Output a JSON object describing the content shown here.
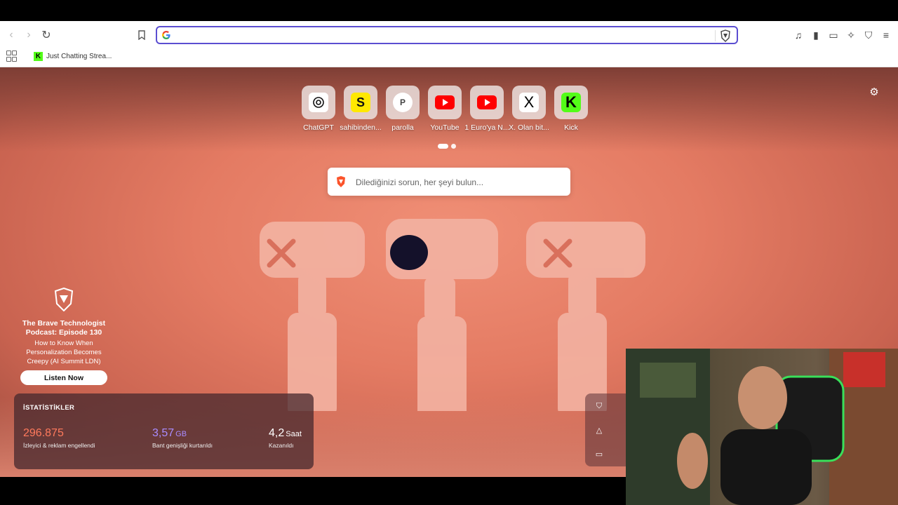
{
  "bookmarks": [
    {
      "label": "Just Chatting Strea..."
    }
  ],
  "address_bar": {
    "value": "",
    "placeholder": ""
  },
  "top_sites": [
    {
      "label": "ChatGPT",
      "icon": "chatgpt-icon"
    },
    {
      "label": "sahibinden...",
      "icon": "sahibinden-icon",
      "glyph": "S"
    },
    {
      "label": "parolla",
      "icon": "parolla-icon",
      "glyph": "P"
    },
    {
      "label": "YouTube",
      "icon": "youtube-icon"
    },
    {
      "label": "1 Euro'ya N...",
      "icon": "youtube-icon"
    },
    {
      "label": "X. Olan bit...",
      "icon": "x-icon",
      "glyph": "X"
    },
    {
      "label": "Kick",
      "icon": "kick-icon",
      "glyph": "K"
    }
  ],
  "search": {
    "placeholder": "Dilediğinizi sorun, her şeyi bulun..."
  },
  "sponsor": {
    "title": "The Brave Technologist Podcast: Episode 130",
    "description": "How to Know When Personalization Becomes Creepy (AI Summit LDN)",
    "button": "Listen Now"
  },
  "stats": {
    "header": "İSTATİSTİKLER",
    "trackers": {
      "value": "296.875",
      "label": "İzleyici & reklam engellendi",
      "color": "#ff7a5c"
    },
    "bandwidth": {
      "value": "3,57",
      "unit": "GB",
      "label": "Bant genişliği kurtarıldı",
      "color": "#a98cff"
    },
    "time": {
      "value": "4,2",
      "unit": "Saat",
      "label": "Kazanıldı",
      "color": "#ffffff"
    }
  },
  "colors": {
    "accent": "#5b4ed1",
    "kick": "#53fc18",
    "youtube": "#ff0000",
    "sahibinden": "#ffe800"
  }
}
